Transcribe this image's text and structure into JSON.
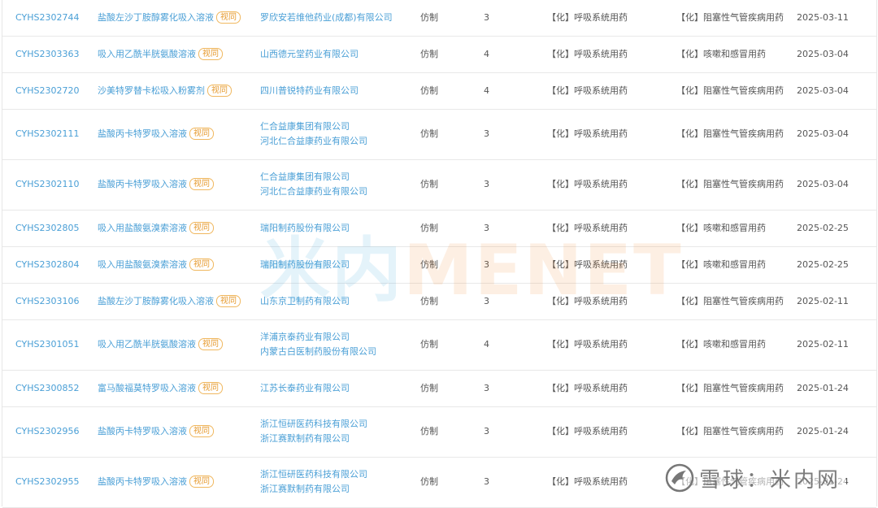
{
  "badge_label": "视同",
  "rows": [
    {
      "code": "CYHS2302744",
      "drug": "盐酸左沙丁胺醇雾化吸入溶液",
      "badge": true,
      "companies": [
        "罗欣安若维他药业(成都)有限公司"
      ],
      "reg_type": "仿制",
      "category": "3",
      "class": "【化】呼吸系统用药",
      "subclass": "【化】阻塞性气管疾病用药",
      "date": "2025-03-11"
    },
    {
      "code": "CYHS2303363",
      "drug": "吸入用乙酰半胱氨酸溶液",
      "badge": true,
      "companies": [
        "山西德元堂药业有限公司"
      ],
      "reg_type": "仿制",
      "category": "4",
      "class": "【化】呼吸系统用药",
      "subclass": "【化】咳嗽和感冒用药",
      "date": "2025-03-04"
    },
    {
      "code": "CYHS2302720",
      "drug": "沙美特罗替卡松吸入粉雾剂",
      "badge": true,
      "companies": [
        "四川普锐特药业有限公司"
      ],
      "reg_type": "仿制",
      "category": "4",
      "class": "【化】呼吸系统用药",
      "subclass": "【化】阻塞性气管疾病用药",
      "date": "2025-03-04"
    },
    {
      "code": "CYHS2302111",
      "drug": "盐酸丙卡特罗吸入溶液",
      "badge": true,
      "companies": [
        "仁合益康集团有限公司",
        "河北仁合益康药业有限公司"
      ],
      "reg_type": "仿制",
      "category": "3",
      "class": "【化】呼吸系统用药",
      "subclass": "【化】阻塞性气管疾病用药",
      "date": "2025-03-04"
    },
    {
      "code": "CYHS2302110",
      "drug": "盐酸丙卡特罗吸入溶液",
      "badge": true,
      "companies": [
        "仁合益康集团有限公司",
        "河北仁合益康药业有限公司"
      ],
      "reg_type": "仿制",
      "category": "3",
      "class": "【化】呼吸系统用药",
      "subclass": "【化】阻塞性气管疾病用药",
      "date": "2025-03-04"
    },
    {
      "code": "CYHS2302805",
      "drug": "吸入用盐酸氨溴索溶液",
      "badge": true,
      "companies": [
        "瑞阳制药股份有限公司"
      ],
      "reg_type": "仿制",
      "category": "3",
      "class": "【化】呼吸系统用药",
      "subclass": "【化】咳嗽和感冒用药",
      "date": "2025-02-25"
    },
    {
      "code": "CYHS2302804",
      "drug": "吸入用盐酸氨溴索溶液",
      "badge": true,
      "companies": [
        "瑞阳制药股份有限公司"
      ],
      "reg_type": "仿制",
      "category": "3",
      "class": "【化】呼吸系统用药",
      "subclass": "【化】咳嗽和感冒用药",
      "date": "2025-02-25"
    },
    {
      "code": "CYHS2303106",
      "drug": "盐酸左沙丁胺醇雾化吸入溶液",
      "badge": true,
      "companies": [
        "山东京卫制药有限公司"
      ],
      "reg_type": "仿制",
      "category": "3",
      "class": "【化】呼吸系统用药",
      "subclass": "【化】阻塞性气管疾病用药",
      "date": "2025-02-11"
    },
    {
      "code": "CYHS2301051",
      "drug": "吸入用乙酰半胱氨酸溶液",
      "badge": true,
      "companies": [
        "洋浦京泰药业有限公司",
        "内蒙古白医制药股份有限公司"
      ],
      "reg_type": "仿制",
      "category": "4",
      "class": "【化】呼吸系统用药",
      "subclass": "【化】咳嗽和感冒用药",
      "date": "2025-02-11"
    },
    {
      "code": "CYHS2300852",
      "drug": "富马酸福莫特罗吸入溶液",
      "badge": true,
      "companies": [
        "江苏长泰药业有限公司"
      ],
      "reg_type": "仿制",
      "category": "3",
      "class": "【化】呼吸系统用药",
      "subclass": "【化】阻塞性气管疾病用药",
      "date": "2025-01-24"
    },
    {
      "code": "CYHS2302956",
      "drug": "盐酸丙卡特罗吸入溶液",
      "badge": true,
      "companies": [
        "浙江恒研医药科技有限公司",
        "浙江赛默制药有限公司"
      ],
      "reg_type": "仿制",
      "category": "3",
      "class": "【化】呼吸系统用药",
      "subclass": "【化】阻塞性气管疾病用药",
      "date": "2025-01-24"
    },
    {
      "code": "CYHS2302955",
      "drug": "盐酸丙卡特罗吸入溶液",
      "badge": true,
      "companies": [
        "浙江恒研医药科技有限公司",
        "浙江赛默制药有限公司"
      ],
      "reg_type": "仿制",
      "category": "3",
      "class": "【化】呼吸系统用药",
      "subclass": "【化】阻塞性气管疾病用药",
      "date": "2025-01-24"
    }
  ],
  "watermark": {
    "cn": "米内",
    "en": "MENET"
  },
  "footer_watermark": {
    "text": "雪球：米内网"
  },
  "icons": {
    "footer_logo": "snowball-logo-icon"
  },
  "colors": {
    "link": "#4a9fd6",
    "badge": "#e69a2e",
    "border": "#e8e8e8"
  }
}
